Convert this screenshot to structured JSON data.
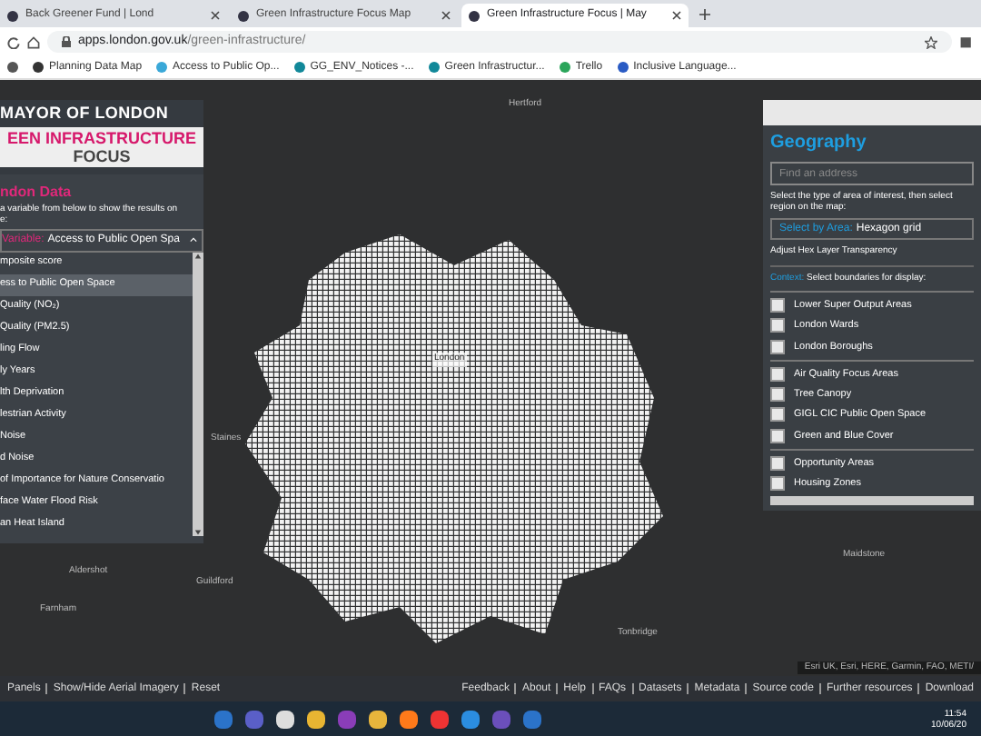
{
  "browser": {
    "tabs": [
      {
        "title": "Back Greener Fund | Lond",
        "selected": false
      },
      {
        "title": "Green Infrastructure Focus Map",
        "selected": false
      },
      {
        "title": "Green Infrastructure Focus | May",
        "selected": true
      }
    ],
    "url_host": "apps.london.gov.uk",
    "url_path": "/green-infrastructure/",
    "bookmarks": [
      "Planning Data Map",
      "Access to Public Op...",
      "GG_ENV_Notices -...",
      "Green Infrastructur...",
      "Trello",
      "Inclusive Language..."
    ]
  },
  "map": {
    "places": [
      {
        "name": "Hertford"
      },
      {
        "name": "London"
      },
      {
        "name": "Staines"
      },
      {
        "name": "Aldershot"
      },
      {
        "name": "Farnham"
      },
      {
        "name": "Guildford"
      },
      {
        "name": "Maidstone"
      },
      {
        "name": "Tonbridge"
      }
    ],
    "attribution": "Esri UK, Esri, HERE, Garmin, FAO, METI/"
  },
  "left_panel": {
    "org": "MAYOR OF LONDON",
    "title_line_1": "EEN INFRASTRUCTURE",
    "title_line_2": "FOCUS",
    "section": "ndon Data",
    "instructions": "a variable from below to show the results on",
    "instructions_2": "e:",
    "variable_label": "Variable:",
    "variable_value": "Access to Public Open Spa",
    "options": [
      {
        "label": "mposite score",
        "selected": false
      },
      {
        "label": "ess to Public Open Space",
        "selected": true
      },
      {
        "label": "Quality (NO₂)",
        "selected": false
      },
      {
        "label": "Quality (PM2.5)",
        "selected": false
      },
      {
        "label": "ling Flow",
        "selected": false
      },
      {
        "label": "ly Years",
        "selected": false
      },
      {
        "label": "lth Deprivation",
        "selected": false
      },
      {
        "label": "lestrian Activity",
        "selected": false
      },
      {
        "label": "Noise",
        "selected": false
      },
      {
        "label": "d Noise",
        "selected": false
      },
      {
        "label": "of Importance for Nature Conservatio",
        "selected": false
      },
      {
        "label": "face Water Flood Risk",
        "selected": false
      },
      {
        "label": "an Heat Island",
        "selected": false
      }
    ]
  },
  "right_panel": {
    "heading": "Geography",
    "search": {
      "placeholder": "Find an address"
    },
    "instructions": "Select the type of area of interest, then select region on the map:",
    "area_label": "Select by Area:",
    "area_value": "Hexagon grid",
    "transparency": "Adjust Hex Layer Transparency",
    "context_label": "Context:",
    "context_text": "Select boundaries for display:",
    "groups": [
      [
        {
          "label": "Lower Super Output Areas",
          "checked": false
        },
        {
          "label": "London Wards",
          "checked": false
        },
        {
          "label": "London Boroughs",
          "checked": false
        }
      ],
      [
        {
          "label": "Air Quality Focus Areas",
          "checked": false
        },
        {
          "label": "Tree Canopy",
          "checked": false
        },
        {
          "label": "GIGL CIC Public Open Space",
          "checked": false
        },
        {
          "label": "Green and Blue Cover",
          "checked": false
        }
      ],
      [
        {
          "label": "Opportunity Areas",
          "checked": false
        },
        {
          "label": "Housing Zones",
          "checked": false
        }
      ]
    ]
  },
  "footer": {
    "left_links": [
      "Panels",
      "Show/Hide Aerial Imagery",
      "Reset"
    ],
    "right_links": [
      "Feedback",
      "About",
      "Help",
      "FAQs",
      "Datasets",
      "Metadata",
      "Source code",
      "Further resources",
      "Download"
    ]
  },
  "taskbar": {
    "time": "11:54",
    "date": "10/06/20"
  }
}
